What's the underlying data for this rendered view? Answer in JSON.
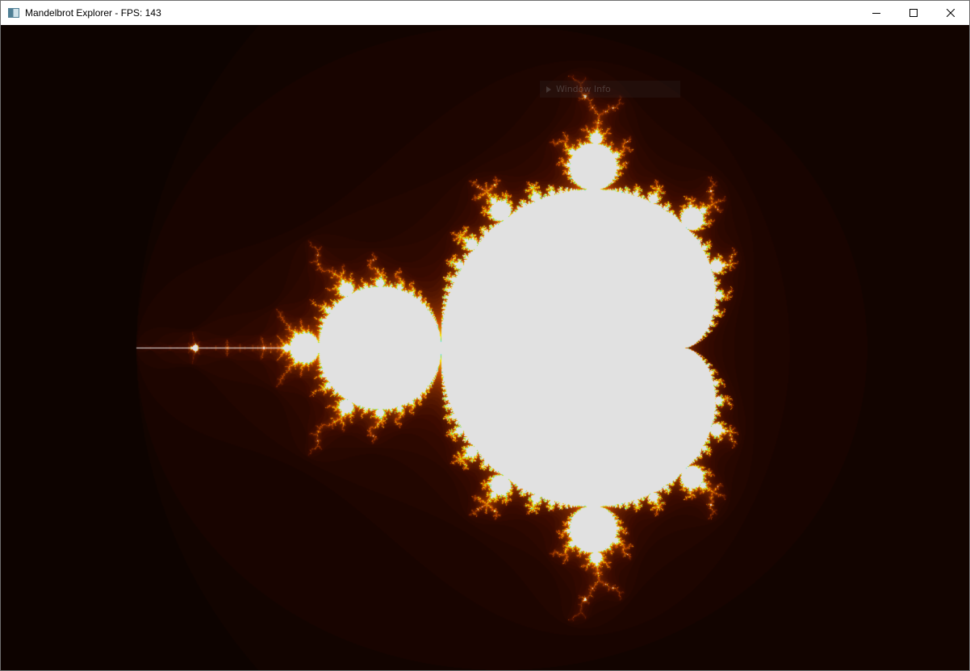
{
  "window": {
    "title": "Mandelbrot Explorer - FPS: 143",
    "icon": "app-window-icon",
    "controls": {
      "minimize_icon": "minimize-icon",
      "maximize_icon": "maximize-icon",
      "close_icon": "close-icon"
    }
  },
  "overlay": {
    "title": "Window Info",
    "collapsed": true,
    "arrow_icon": "collapse-arrow-icon"
  },
  "colors": {
    "background": "#000000",
    "set_fill": "#e1e1e1",
    "glow_inner": "#ffd200",
    "glow_outer": "#3a0c00"
  }
}
